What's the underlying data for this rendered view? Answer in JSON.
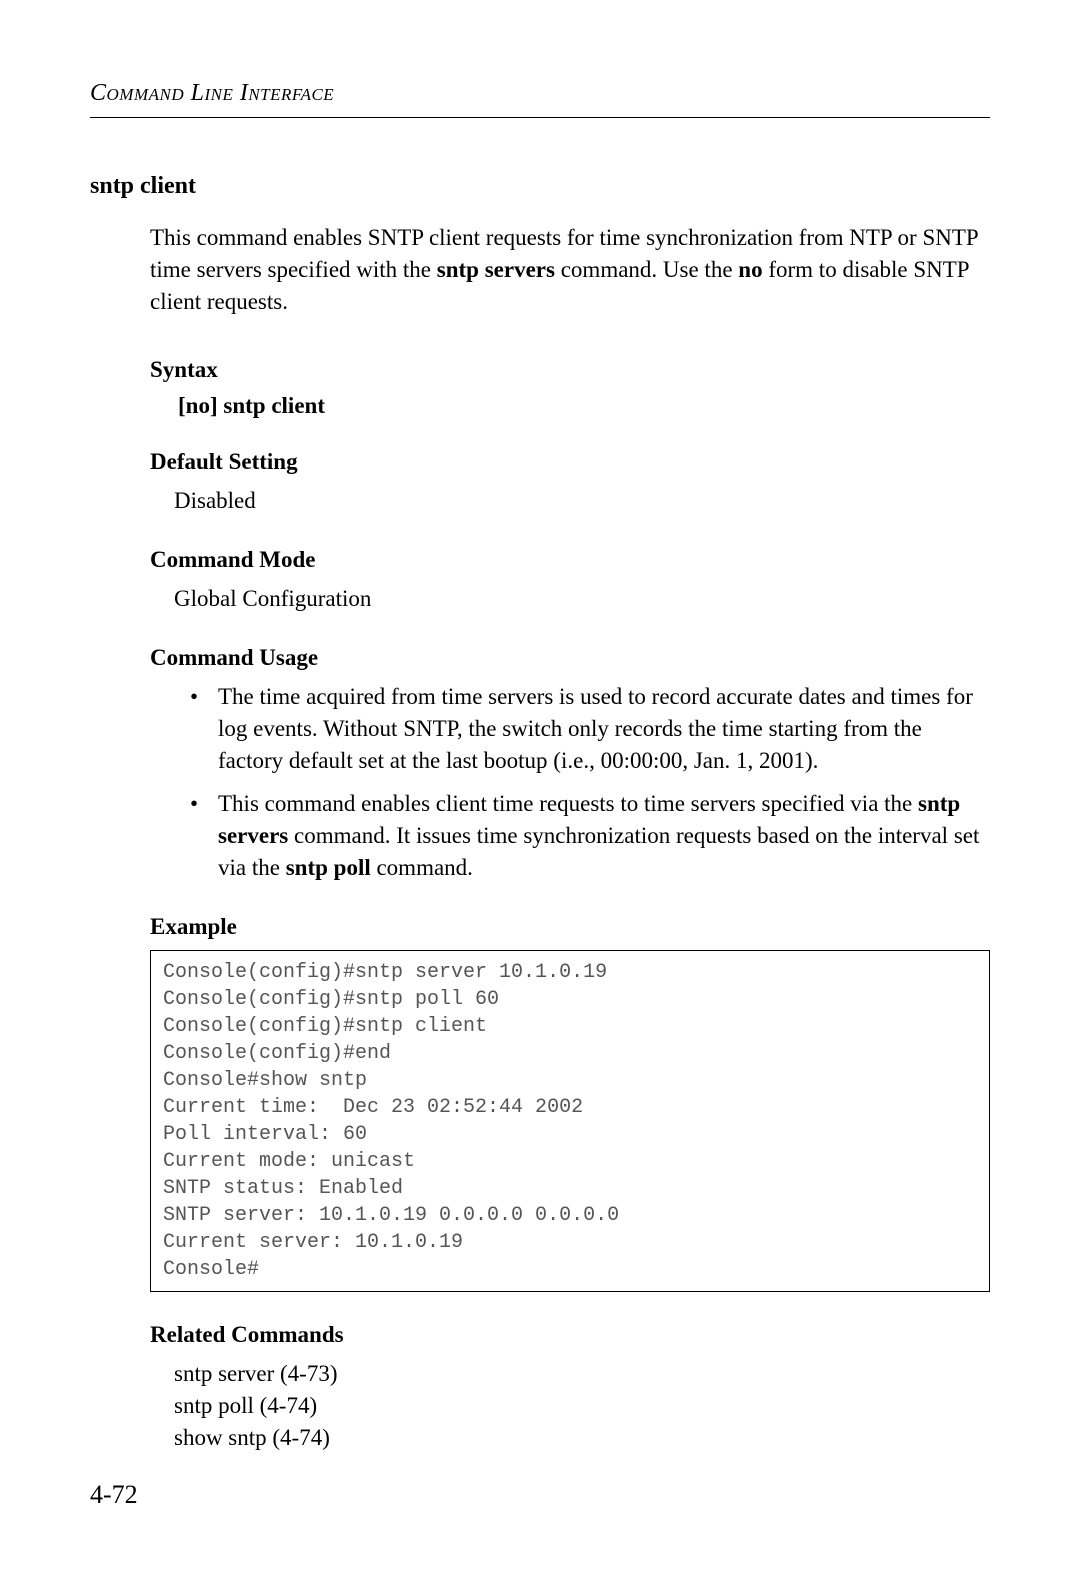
{
  "header": "Command Line Interface",
  "commandTitle": "sntp client",
  "description": {
    "part1": "This command enables SNTP client requests for time synchronization from NTP or SNTP time servers specified with the ",
    "bold1": "sntp servers",
    "part2": " command. Use the ",
    "bold2": "no",
    "part3": " form to disable SNTP client requests."
  },
  "syntax": {
    "heading": "Syntax",
    "prefix": "[",
    "boldNo": "no",
    "bracket": "] ",
    "boldCmd": "sntp client"
  },
  "defaultSetting": {
    "heading": "Default Setting",
    "value": "Disabled"
  },
  "commandMode": {
    "heading": "Command Mode",
    "value": "Global Configuration"
  },
  "commandUsage": {
    "heading": "Command Usage",
    "item1": "The time acquired from time servers is used to record accurate dates and times for log events. Without SNTP, the switch only records the time starting from the factory default set at the last bootup (i.e., 00:00:00, Jan. 1, 2001).",
    "item2": {
      "p1": "This command enables client time requests to time servers specified via the ",
      "b1": "sntp servers",
      "p2": " command. It issues time synchronization requests based on the interval set via the ",
      "b2": "sntp poll",
      "p3": " command."
    }
  },
  "example": {
    "heading": "Example",
    "code": "Console(config)#sntp server 10.1.0.19\nConsole(config)#sntp poll 60\nConsole(config)#sntp client\nConsole(config)#end\nConsole#show sntp\nCurrent time:  Dec 23 02:52:44 2002\nPoll interval: 60\nCurrent mode: unicast\nSNTP status: Enabled\nSNTP server: 10.1.0.19 0.0.0.0 0.0.0.0\nCurrent server: 10.1.0.19\nConsole#"
  },
  "relatedCommands": {
    "heading": "Related Commands",
    "items": [
      "sntp server (4-73)",
      "sntp poll (4-74)",
      "show sntp (4-74)"
    ]
  },
  "pageNumber": "4-72"
}
